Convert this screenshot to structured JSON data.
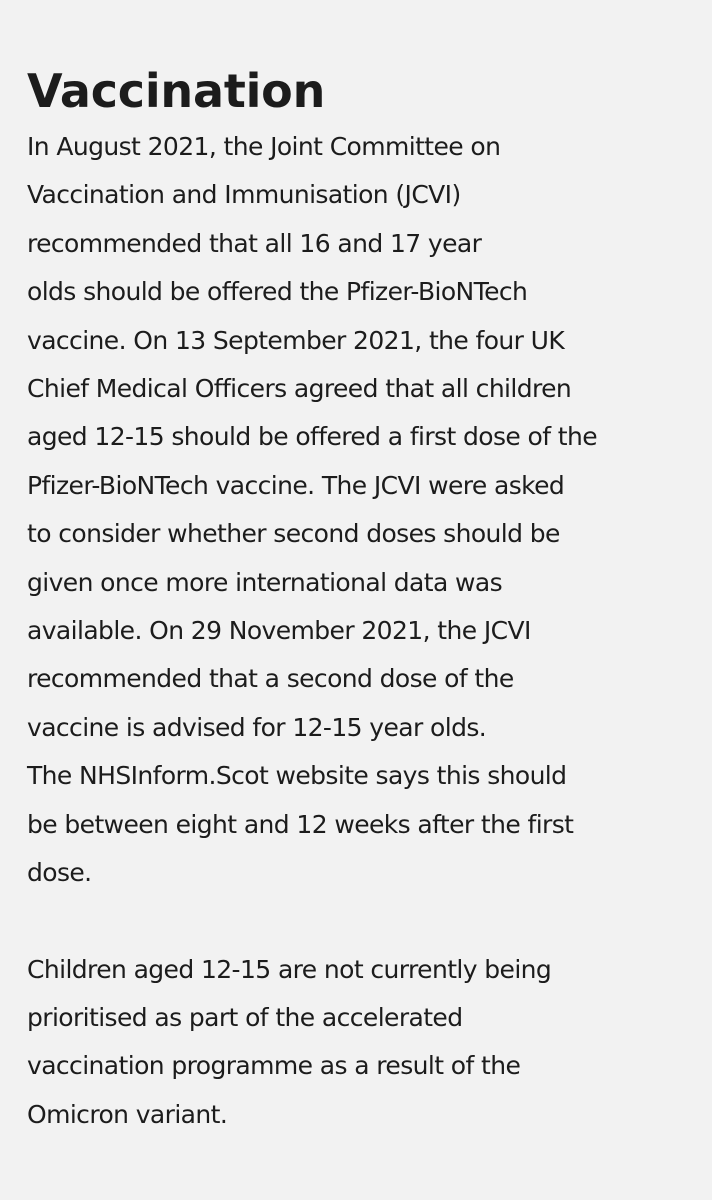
{
  "article": {
    "heading": "Vaccination",
    "paragraphs": [
      {
        "lines": [
          "In August 2021, the Joint Committee on",
          "Vaccination and Immunisation (JCVI)",
          "recommended that all 16 and 17 year",
          "olds should be offered the Pfizer-BioNTech",
          "vaccine. On 13 September 2021, the four UK",
          "Chief Medical Officers agreed that all children",
          "aged 12-15 should be offered a first dose of the",
          "Pfizer-BioNTech vaccine. The JCVI were asked",
          "to consider whether second doses should be",
          "given once more international data was",
          "available. On 29 November 2021, the JCVI",
          "recommended that a second dose of the",
          "vaccine is advised for 12-15 year olds.",
          "The NHSInform.Scot website says this should",
          "be between eight and 12 weeks after the first",
          "dose."
        ]
      },
      {
        "lines": [
          "Children aged 12-15 are not currently being",
          "prioritised as part of the accelerated",
          "vaccination programme as a result of the",
          "Omicron variant."
        ]
      }
    ]
  }
}
